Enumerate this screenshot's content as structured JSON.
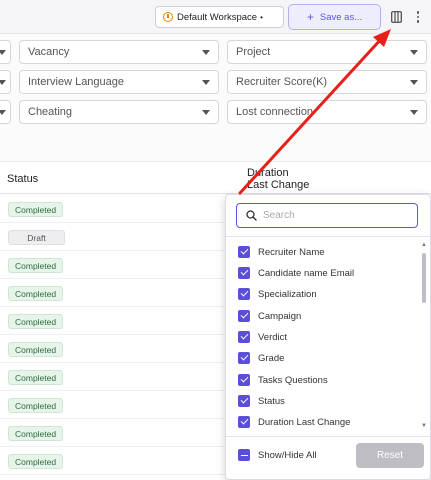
{
  "toolbar": {
    "workspace_label": "Default Workspace",
    "workspace_dot": "•",
    "save_label": "Save as...",
    "save_plus": "+"
  },
  "filters": {
    "col_mid": [
      "Vacancy",
      "Interview Language",
      "Cheating"
    ],
    "col_right": [
      "Project",
      "Recruiter Score(K)",
      "Lost connection"
    ]
  },
  "table": {
    "headers": {
      "status": "Status",
      "duration_line1": "Duration",
      "duration_line2": "Last Change"
    },
    "rows": [
      {
        "status": "Completed",
        "kind": "completed"
      },
      {
        "status": "Draft",
        "kind": "draft"
      },
      {
        "status": "Completed",
        "kind": "completed"
      },
      {
        "status": "Completed",
        "kind": "completed"
      },
      {
        "status": "Completed",
        "kind": "completed"
      },
      {
        "status": "Completed",
        "kind": "completed"
      },
      {
        "status": "Completed",
        "kind": "completed"
      },
      {
        "status": "Completed",
        "kind": "completed"
      },
      {
        "status": "Completed",
        "kind": "completed"
      },
      {
        "status": "Completed",
        "kind": "completed"
      }
    ]
  },
  "column_picker": {
    "search_placeholder": "Search",
    "options": [
      {
        "label": "Recruiter Name",
        "checked": true
      },
      {
        "label": "Candidate name Email",
        "checked": true
      },
      {
        "label": "Specialization",
        "checked": true
      },
      {
        "label": "Campaign",
        "checked": true
      },
      {
        "label": "Verdict",
        "checked": true
      },
      {
        "label": "Grade",
        "checked": true
      },
      {
        "label": "Tasks Questions",
        "checked": true
      },
      {
        "label": "Status",
        "checked": true
      },
      {
        "label": "Duration Last Change",
        "checked": true
      }
    ],
    "show_hide_all": "Show/Hide All",
    "reset_label": "Reset"
  },
  "colors": {
    "accent": "#5c56e0",
    "checkbox": "#5b4fd9",
    "annotation_arrow": "#e8201a",
    "completed_bg": "#e6f4ea"
  }
}
